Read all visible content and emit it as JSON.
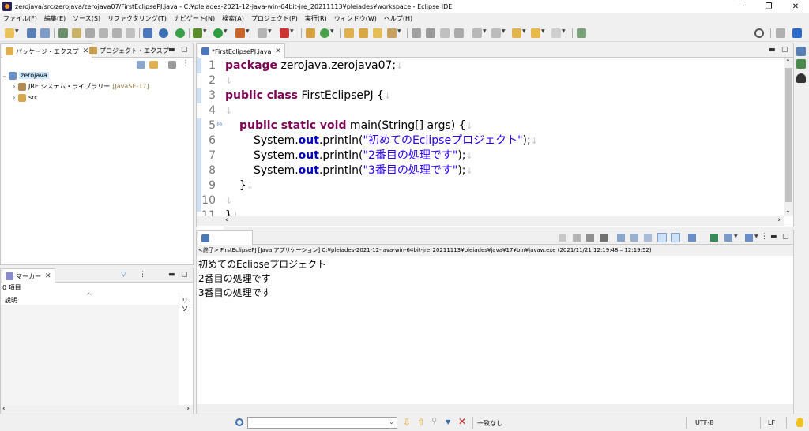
{
  "window": {
    "title": "zerojava/src/zerojava/zerojava07/FirstEclipsePJ.java - C:¥pleiades-2021-12-java-win-64bit-jre_20211113¥pleiades¥workspace - Eclipse IDE",
    "minimize": "─",
    "maximize": "❐",
    "close": "✕"
  },
  "menu": [
    "ファイル(F)",
    "編集(E)",
    "ソース(S)",
    "リファクタリング(T)",
    "ナビゲート(N)",
    "検索(A)",
    "プロジェクト(P)",
    "実行(R)",
    "ウィンドウ(W)",
    "ヘルプ(H)"
  ],
  "package_explorer": {
    "tab_label": "パッケージ・エクスプ",
    "tab2_label": "プロジェクト・エクスプ",
    "tree": [
      {
        "label": "zerojava",
        "expanded": true,
        "selected": true
      },
      {
        "label": "JRE システム・ライブラリー",
        "suffix": "[JavaSE-17]"
      },
      {
        "label": "src"
      }
    ]
  },
  "markers": {
    "tab_label": "マーカー",
    "count": "0 項目",
    "col_description": "説明",
    "col_resource": "リソ"
  },
  "editor": {
    "tab_label": "*FirstEclipsePJ.java",
    "line_numbers": [
      "1",
      "2",
      "3",
      "4",
      "5",
      "6",
      "7",
      "8",
      "9",
      "10",
      "11"
    ],
    "lines": {
      "l1_kw": "package",
      "l1_rest": " zerojava.zerojava07;",
      "l3_kw": "public class",
      "l3_rest": " FirstEclipsePJ {",
      "l5_kw": "public static void",
      "l5_rest": " main(String[] args) {",
      "l6_a": "System.",
      "l6_out": "out",
      "l6_b": ".println(",
      "l6_str": "\"初めてのEclipseプロジェクト\"",
      "l6_c": ");",
      "l7_a": "System.",
      "l7_out": "out",
      "l7_b": ".println(",
      "l7_str": "\"2番目の処理です\"",
      "l7_c": ");",
      "l8_a": "System.",
      "l8_out": "out",
      "l8_b": ".println(",
      "l8_str": "\"3番目の処理です\"",
      "l8_c": ");",
      "l9": "}",
      "l11": "}"
    },
    "fold_marker": "⊖",
    "return_mark": "↓"
  },
  "console": {
    "header": "<終了> FirstEclipsePJ [Java アプリケーション] C:¥pleiades-2021-12-java-win-64bit-jre_20211113¥pleiades¥java¥17¥bin¥javaw.exe  (2021/11/21 12:19:48 – 12:19:52)",
    "output": [
      "初めてのEclipseプロジェクト",
      "2番目の処理です",
      "3番目の処理です"
    ]
  },
  "status": {
    "search_placeholder": "",
    "match": "一致なし",
    "encoding": "UTF-8",
    "line_ending": "LF"
  },
  "colors": {
    "keyword": "#7f0055",
    "string": "#2a00ff",
    "field": "#0000c0",
    "linenum": "#787878"
  }
}
